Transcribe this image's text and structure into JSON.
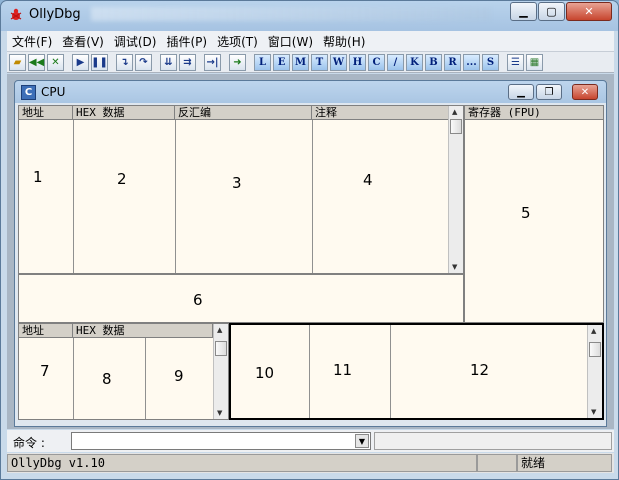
{
  "window": {
    "title": "OllyDbg"
  },
  "menu": [
    "文件(F)",
    "查看(V)",
    "调试(D)",
    "插件(P)",
    "选项(T)",
    "窗口(W)",
    "帮助(H)"
  ],
  "toolbar_letters": [
    "L",
    "E",
    "M",
    "T",
    "W",
    "H",
    "C",
    "/",
    "K",
    "B",
    "R",
    "...",
    "S"
  ],
  "cpu": {
    "title": "CPU",
    "disasm_headers": [
      "地址",
      "HEX 数据",
      "反汇编",
      "注释"
    ],
    "registers_header": "寄存器 (FPU)",
    "dump_headers": [
      "地址",
      "HEX 数据"
    ]
  },
  "labels": {
    "p1": "1",
    "p2": "2",
    "p3": "3",
    "p4": "4",
    "p5": "5",
    "p6": "6",
    "p7": "7",
    "p8": "8",
    "p9": "9",
    "p10": "10",
    "p11": "11",
    "p12": "12"
  },
  "command": {
    "label": "命令 :"
  },
  "status": {
    "version": "OllyDbg v1.10",
    "state": "就绪"
  },
  "colors": {
    "pane_bg": "#fffaf0",
    "title_bg": "#a6c3e2"
  }
}
